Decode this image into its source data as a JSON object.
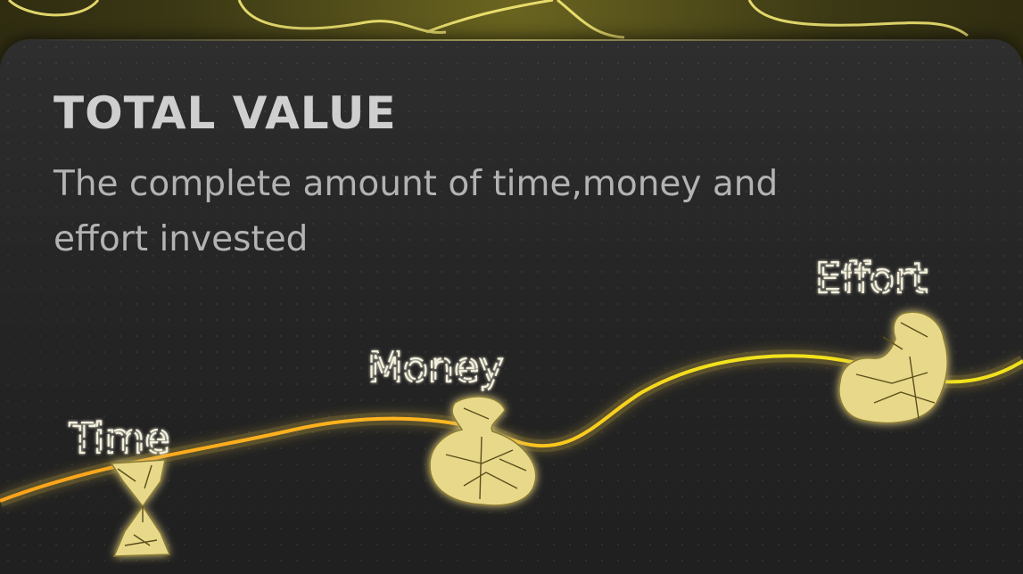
{
  "title": "TOTAL VALUE",
  "subtitle": "The complete amount of time,money and effort invested",
  "milestones": [
    {
      "label": "Time"
    },
    {
      "label": "Money"
    },
    {
      "label": "Effort"
    }
  ],
  "colors": {
    "line_start": "#ffa31a",
    "line_end": "#f2e21c",
    "glow": "#ffd84a",
    "card": "#262626",
    "title": "#cfcfcf",
    "subtitle": "#b3b3b3",
    "label": "#f3f0dc",
    "rock": "#e8d88a"
  }
}
